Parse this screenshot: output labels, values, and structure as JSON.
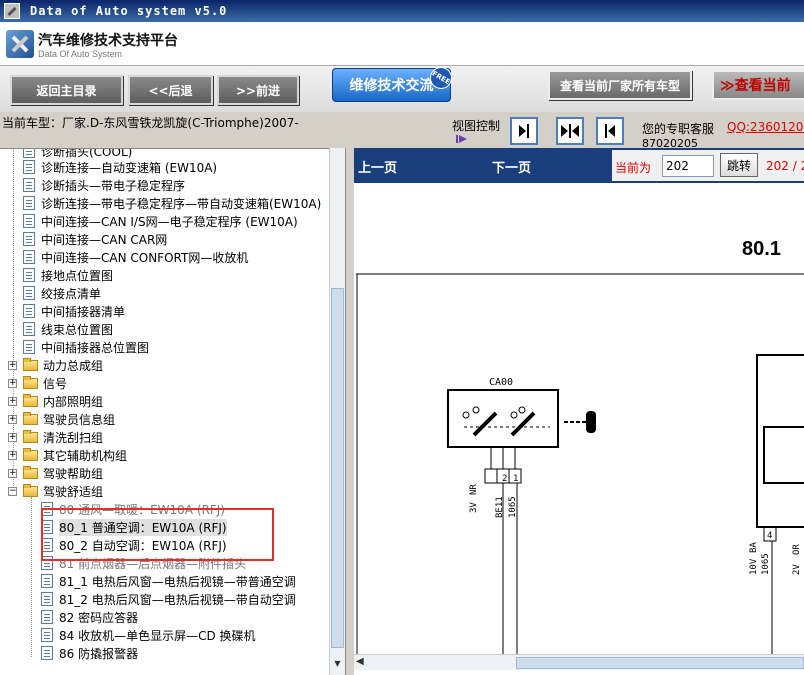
{
  "window": {
    "title": "Data of Auto system v5.0"
  },
  "header": {
    "title": "汽车维修技术支持平台",
    "subtitle": "Data Of Auto System"
  },
  "toolbar": {
    "main_menu": "返回主目录",
    "back": "<<后退",
    "forward": ">>前进",
    "forum": "维修技术交流",
    "free_badge": "FREE",
    "all_models": "查看当前厂家所有车型",
    "current": "≫查看当前"
  },
  "infobar": {
    "current_model": "当前车型：厂家.D-东风雪铁龙凯旋(C-Triomphe)2007-",
    "view_control": "视图控制",
    "service_label": "您的专职客服",
    "qq": "QQ:23601200",
    "phone": "87020205"
  },
  "tree": {
    "items": [
      {
        "label": "诊断插头(COOL)",
        "type": "doc"
      },
      {
        "label": "诊断连接—自动变速箱 (EW10A)",
        "type": "doc"
      },
      {
        "label": "诊断插头—带电子稳定程序",
        "type": "doc"
      },
      {
        "label": "诊断连接—带电子稳定程序—带自动变速箱(EW10A)",
        "type": "doc"
      },
      {
        "label": "中间连接—CAN I/S网—电子稳定程序 (EW10A)",
        "type": "doc"
      },
      {
        "label": "中间连接—CAN CAR网",
        "type": "doc"
      },
      {
        "label": "中间连接—CAN CONFORT网—收放机",
        "type": "doc"
      },
      {
        "label": "接地点位置图",
        "type": "doc"
      },
      {
        "label": "绞接点清单",
        "type": "doc"
      },
      {
        "label": "中间插接器清单",
        "type": "doc"
      },
      {
        "label": "线束总位置图",
        "type": "doc"
      },
      {
        "label": "中间插接器总位置图",
        "type": "doc"
      },
      {
        "label": "动力总成组",
        "type": "folder"
      },
      {
        "label": "信号",
        "type": "folder"
      },
      {
        "label": "内部照明组",
        "type": "folder"
      },
      {
        "label": "驾驶员信息组",
        "type": "folder"
      },
      {
        "label": "清洗刮扫组",
        "type": "folder"
      },
      {
        "label": "其它辅助机构组",
        "type": "folder"
      },
      {
        "label": "驾驶帮助组",
        "type": "folder"
      },
      {
        "label": "驾驶舒适组",
        "type": "folder-open"
      },
      {
        "label": "80 通风—取暖：EW10A (RFJ)",
        "type": "doc-child"
      },
      {
        "label": "80_1 普通空调：EW10A (RFJ)",
        "type": "doc-child"
      },
      {
        "label": "80_2 自动空调：EW10A (RFJ)",
        "type": "doc-child"
      },
      {
        "label": "81 前点烟器—后点烟器—附件插头",
        "type": "doc-child"
      },
      {
        "label": "81_1 电热后风窗—电热后视镜—带普通空调",
        "type": "doc-child"
      },
      {
        "label": "81_2 电热后风窗—电热后视镜—带自动空调",
        "type": "doc-child"
      },
      {
        "label": "82 密码应答器",
        "type": "doc-child"
      },
      {
        "label": "84 收放机—单色显示屏—CD 换碟机",
        "type": "doc-child"
      },
      {
        "label": "86 防撬报警器",
        "type": "doc-child"
      }
    ]
  },
  "pagebar": {
    "prev": "上一页",
    "next": "下一页",
    "current_label": "当前为",
    "page_value": "202",
    "jump": "跳转",
    "page_count": "202 / 2"
  },
  "diagram": {
    "page_number": "80.1",
    "connector_name": "CA00",
    "pin_labels": [
      "3V",
      "NR",
      "1",
      "2",
      "BE11",
      "1065"
    ],
    "right_pin_labels": [
      "10V",
      "BA",
      "4",
      "1065",
      "2V",
      "OR"
    ]
  }
}
